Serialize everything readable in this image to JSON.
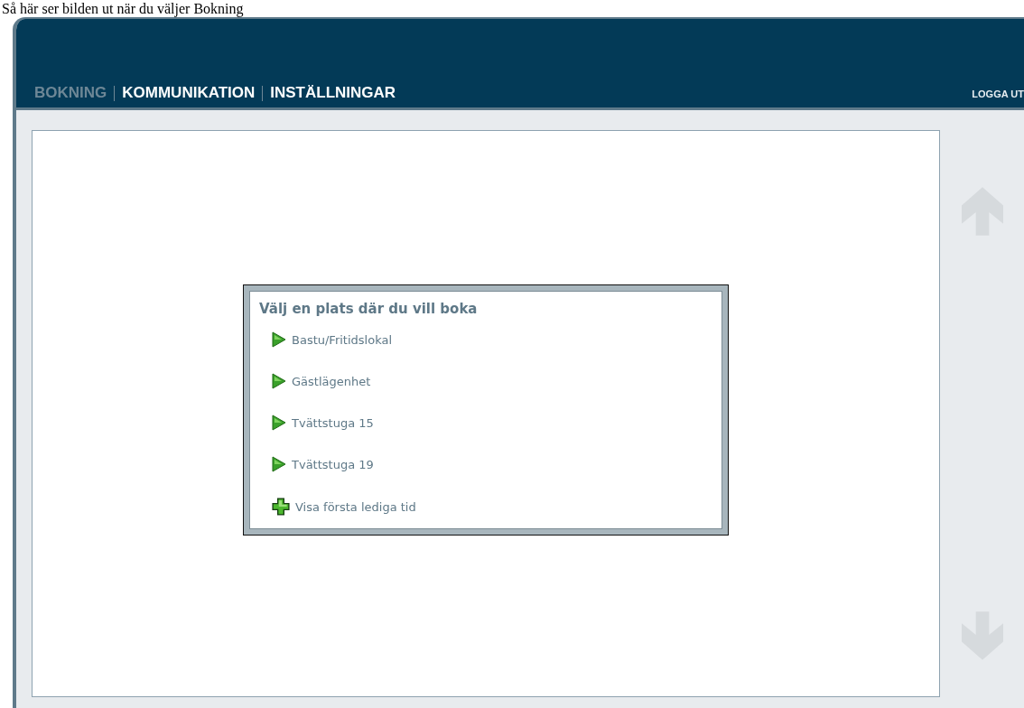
{
  "caption": "Så här ser bilden ut när du väljer Bokning",
  "nav": [
    {
      "label": "BOKNING",
      "selected": true
    },
    {
      "label": "KOMMUNIKATION",
      "selected": false
    },
    {
      "label": "INSTÄLLNINGAR",
      "selected": false
    }
  ],
  "logout": "LOGGA UT",
  "dialog": {
    "title": "Välj en plats där du vill boka",
    "items": [
      {
        "label": "Bastu/Fritidslokal",
        "kind": "arrow"
      },
      {
        "label": "Gästlägenhet",
        "kind": "arrow"
      },
      {
        "label": "Tvättstuga 15",
        "kind": "arrow"
      },
      {
        "label": "Tvättstuga 19",
        "kind": "arrow"
      },
      {
        "label": "Visa första lediga tid",
        "kind": "plus"
      }
    ]
  }
}
